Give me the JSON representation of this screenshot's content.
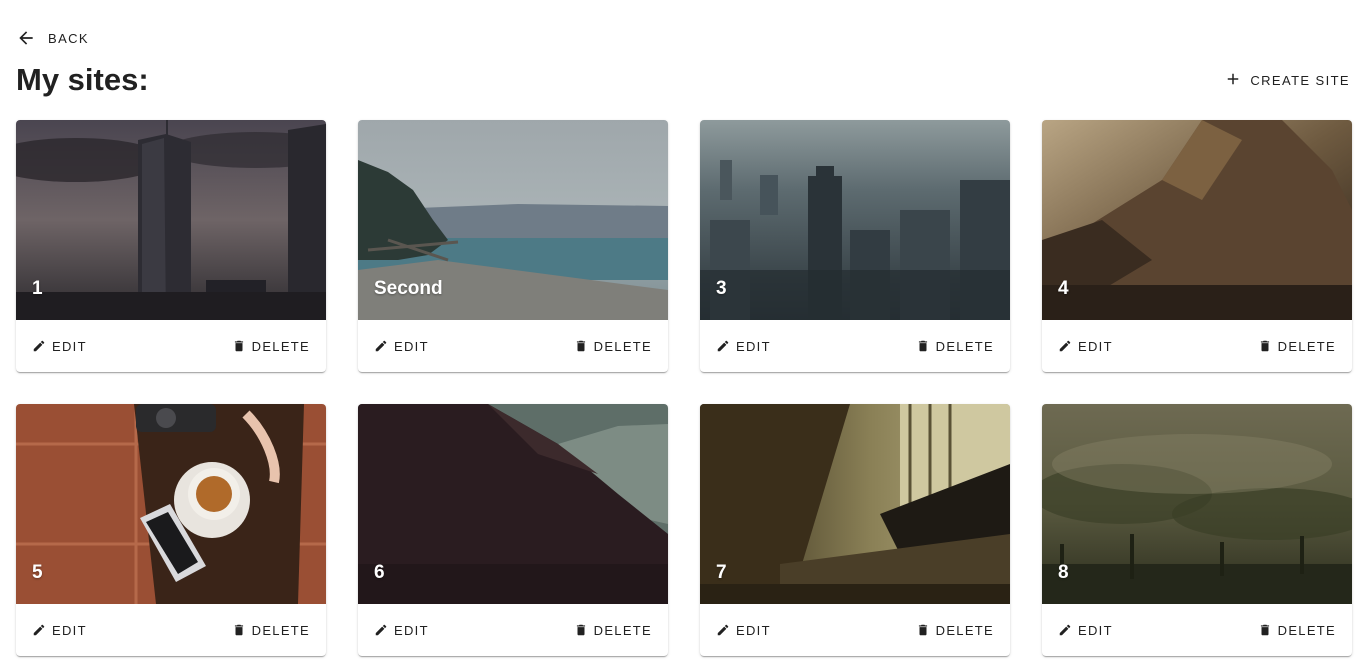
{
  "nav": {
    "back_label": "Back",
    "back_icon": "arrow-left-icon"
  },
  "page": {
    "title": "My sites:"
  },
  "toolbar": {
    "create_label": "Create site",
    "create_icon": "plus-icon"
  },
  "card_actions": {
    "edit_label": "Edit",
    "delete_label": "Delete",
    "edit_icon": "pencil-icon",
    "delete_icon": "trash-icon"
  },
  "sites": [
    {
      "title": "1",
      "image": "city skyline with skyscrapers under dark clouds"
    },
    {
      "title": "Second",
      "image": "beach shoreline with trees and sea"
    },
    {
      "title": "3",
      "image": "hazy aerial city view"
    },
    {
      "title": "4",
      "image": "rocky mountain at sunset"
    },
    {
      "title": "5",
      "image": "table with cup of tea, phone and camera"
    },
    {
      "title": "6",
      "image": "dark mountain slope"
    },
    {
      "title": "7",
      "image": "row of chairs by window"
    },
    {
      "title": "8",
      "image": "foggy forest landscape"
    }
  ]
}
